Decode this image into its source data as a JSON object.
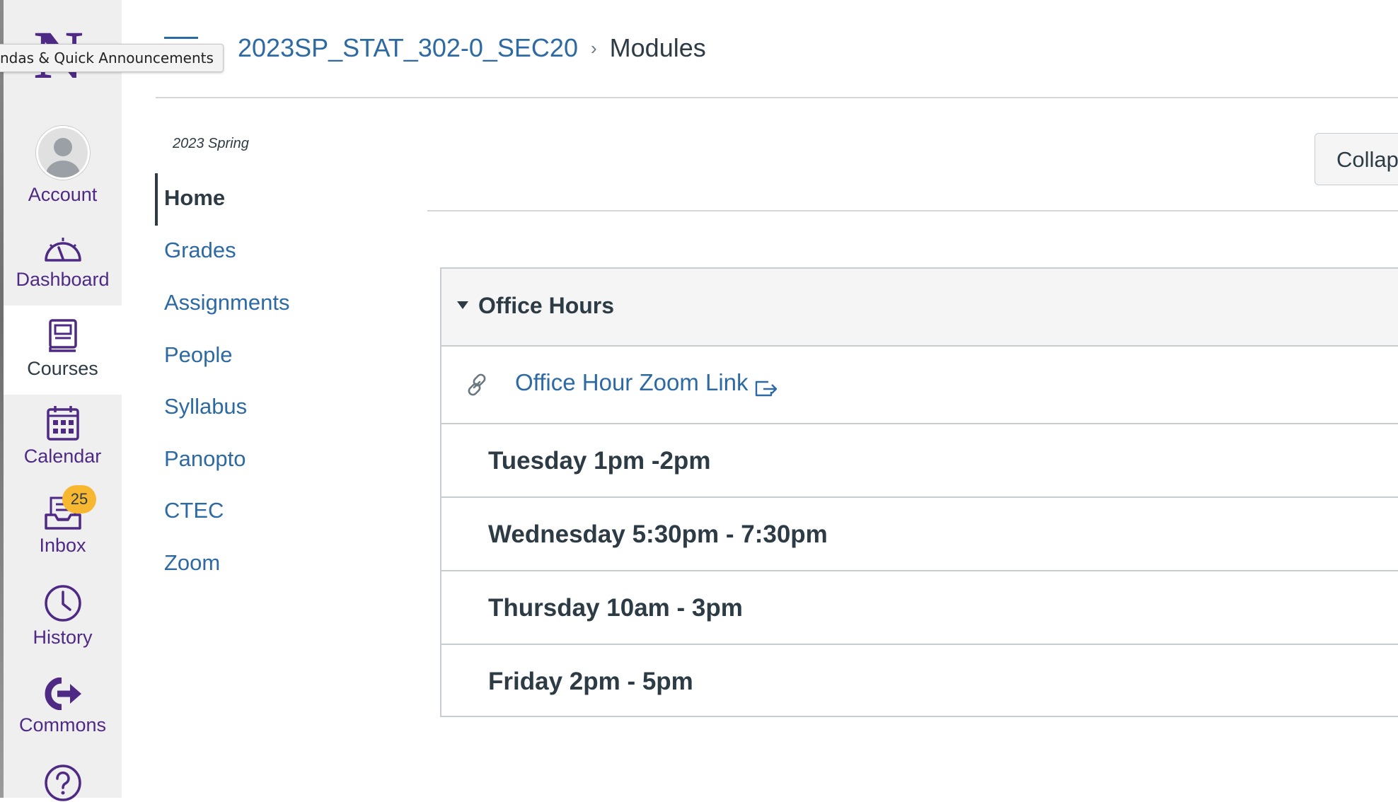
{
  "global_nav": {
    "logo": "N",
    "tooltip": "ndas & Quick Announcements",
    "items": [
      {
        "label": "Account",
        "icon": "avatar-icon"
      },
      {
        "label": "Dashboard",
        "icon": "dashboard-icon"
      },
      {
        "label": "Courses",
        "icon": "courses-icon",
        "active": true
      },
      {
        "label": "Calendar",
        "icon": "calendar-icon"
      },
      {
        "label": "Inbox",
        "icon": "inbox-icon",
        "badge": "25"
      },
      {
        "label": "History",
        "icon": "history-icon"
      },
      {
        "label": "Commons",
        "icon": "commons-icon"
      },
      {
        "label": "",
        "icon": "help-icon"
      }
    ]
  },
  "header": {
    "breadcrumb": {
      "course": "2023SP_STAT_302-0_SEC20",
      "separator": "›",
      "current": "Modules"
    }
  },
  "course_nav": {
    "term": "2023 Spring",
    "items": [
      {
        "label": "Home",
        "active": true
      },
      {
        "label": "Grades"
      },
      {
        "label": "Assignments"
      },
      {
        "label": "People"
      },
      {
        "label": "Syllabus"
      },
      {
        "label": "Panopto"
      },
      {
        "label": "CTEC"
      },
      {
        "label": "Zoom"
      }
    ]
  },
  "toolbar": {
    "collapse_label": "Collap"
  },
  "module": {
    "title": "Office Hours",
    "link_item": "Office Hour Zoom Link",
    "rows": [
      "Tuesday 1pm -2pm",
      "Wednesday 5:30pm - 7:30pm",
      "Thursday 10am - 3pm",
      "Friday 2pm - 5pm"
    ]
  },
  "colors": {
    "brand_purple": "#4e2a84",
    "link_blue": "#2d6aa3",
    "text_dark": "#2d3b45",
    "badge_yellow": "#f7b731"
  }
}
